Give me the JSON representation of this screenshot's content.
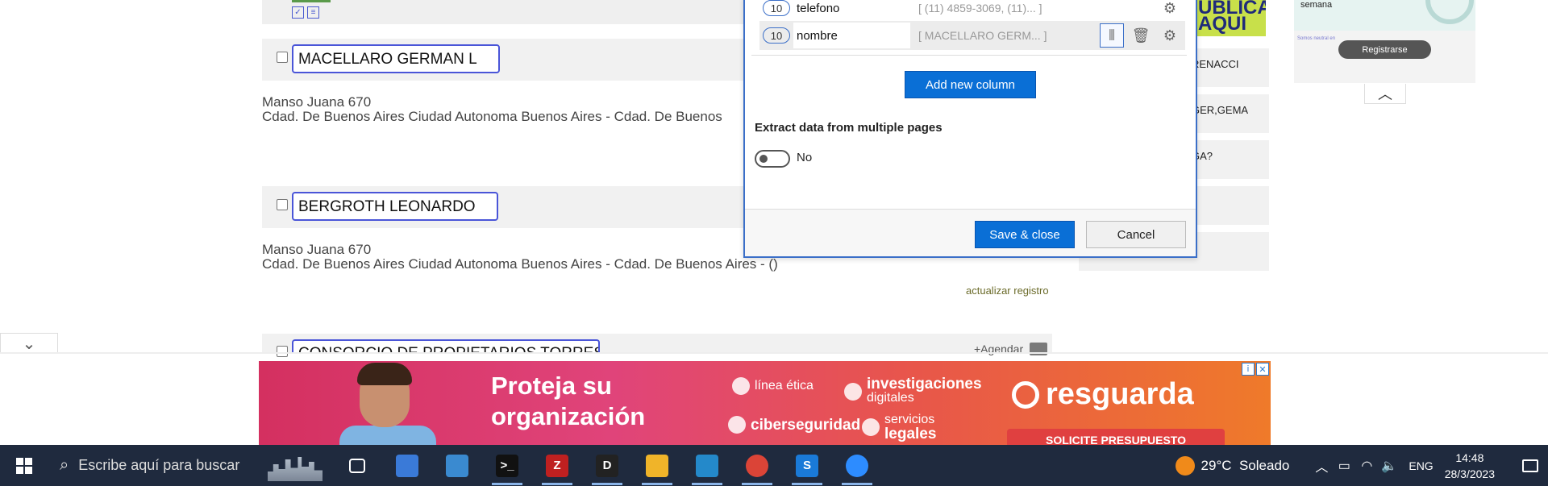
{
  "listing": {
    "records": [
      {
        "name": "MACELLARO GERMAN L",
        "address_line1": "Manso Juana 670",
        "address_line2": "Cdad. De Buenos Aires Ciudad Autonoma Buenos Aires - Cdad. De Buenos"
      },
      {
        "name": "BERGROTH LEONARDO",
        "address_line1": "Manso Juana 670",
        "address_line2": "Cdad. De Buenos Aires Ciudad Autonoma Buenos Aires - Cdad. De Buenos Aires - ()"
      },
      {
        "name": "CONSORCIO DE PROPIETARIOS TORRES"
      }
    ],
    "update_link": "actualizar registro",
    "agendar_label": "+Agendar"
  },
  "sidebar": {
    "ad_text": "UBLICA\nAQUI",
    "items": [
      "RENACCI",
      "GER,GEMA",
      "GA?",
      "",
      ""
    ],
    "promo_text": "semana",
    "promo_small": "Somos neutral en",
    "register_label": "Registrarse"
  },
  "dialog": {
    "columns": [
      {
        "count": "10",
        "name": "telefono",
        "preview": "[ (11) 4859-3069, (11)... ]"
      },
      {
        "count": "10",
        "name": "nombre",
        "preview": "[ MACELLARO GERM... ]"
      }
    ],
    "add_column_label": "Add new column",
    "extract_label": "Extract data from multiple pages",
    "toggle_state": "No",
    "save_label": "Save & close",
    "cancel_label": "Cancel"
  },
  "banner": {
    "headline_line1": "Proteja su",
    "headline_line2": "organización",
    "service1": "línea ética",
    "service2_a": "investigaciones",
    "service2_b": "digitales",
    "service3": "ciberseguridad",
    "service4_a": "servicios",
    "service4_b": "legales",
    "brand": "resguarda",
    "cta": "SOLICITE PRESUPUESTO",
    "info_icon": "i",
    "close_icon": "✕"
  },
  "taskbar": {
    "search_placeholder": "Escribe aquí para buscar",
    "weather": "29°C  Soleado",
    "language": "ENG",
    "time": "14:48",
    "date": "28/3/2023",
    "apps": [
      {
        "name": "task-view",
        "label": "",
        "color": "#1f2a3e"
      },
      {
        "name": "remote-desktop",
        "label": "",
        "color": "#3a7ad8"
      },
      {
        "name": "paint",
        "label": "",
        "color": "#3a8ad0"
      },
      {
        "name": "terminal",
        "label": ">_",
        "color": "#111111"
      },
      {
        "name": "filezilla",
        "label": "Z",
        "color": "#bf2020"
      },
      {
        "name": "dbeaver",
        "label": "D",
        "color": "#222222"
      },
      {
        "name": "file-explorer",
        "label": "",
        "color": "#f0b429"
      },
      {
        "name": "vscode",
        "label": "",
        "color": "#2489ca"
      },
      {
        "name": "chrome",
        "label": "",
        "color": "#db4437"
      },
      {
        "name": "app-s",
        "label": "S",
        "color": "#1a7ad8"
      },
      {
        "name": "zoom",
        "label": "",
        "color": "#2d8cff"
      }
    ]
  }
}
